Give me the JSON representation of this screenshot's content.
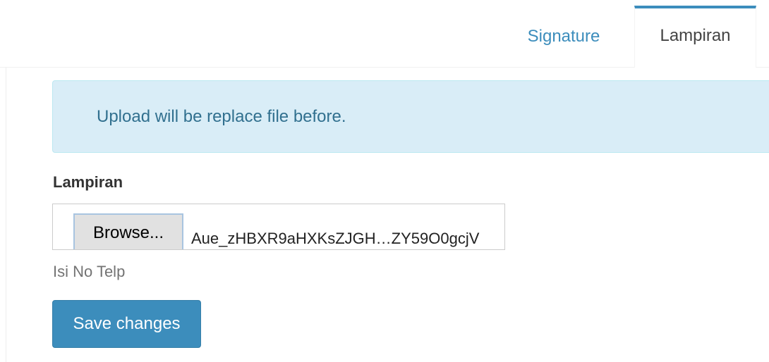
{
  "tabs": [
    {
      "label": "Signature",
      "active": false
    },
    {
      "label": "Lampiran",
      "active": true
    }
  ],
  "alert": {
    "message": "Upload will be replace file before."
  },
  "form": {
    "field_label": "Lampiran",
    "browse_label": "Browse...",
    "file_name": "Aue_zHBXR9aHXKsZJGH…ZY59O0gcjV",
    "help_text": "Isi No Telp",
    "save_label": "Save changes"
  },
  "colors": {
    "accent": "#3c8dbc",
    "alert_bg": "#d9edf7",
    "alert_text": "#31708f"
  }
}
